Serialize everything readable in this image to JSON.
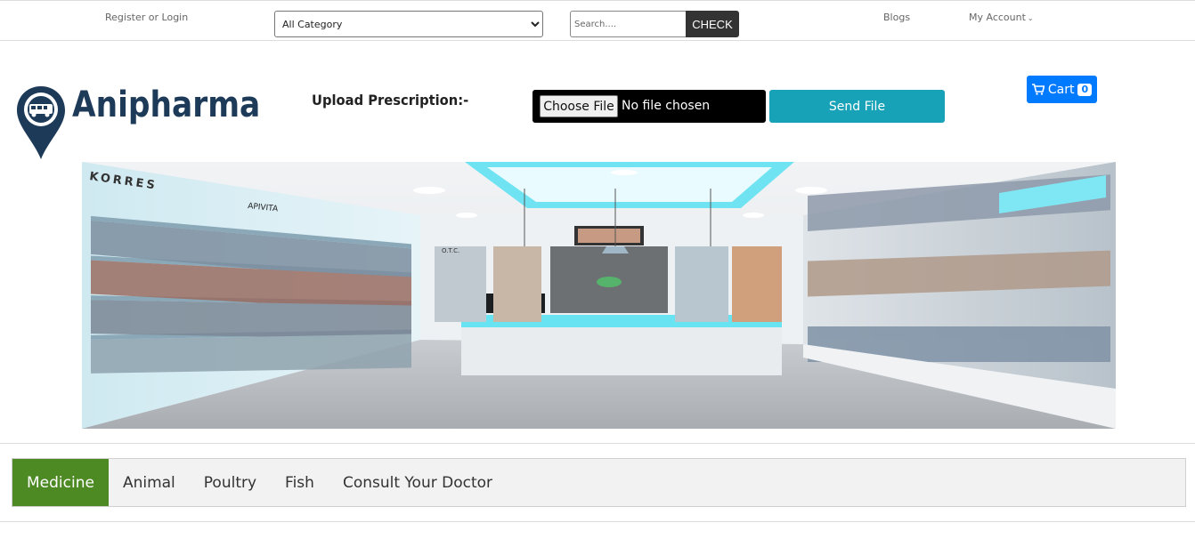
{
  "topbar": {
    "register_login": "Register or Login",
    "category_selected": "All Category",
    "search_placeholder": "Search....",
    "check_label": "CHECK",
    "blogs": "Blogs",
    "my_account": "My Account"
  },
  "brand": {
    "logo_text": "Anipharma",
    "brand_color": "#1d3a58"
  },
  "upload": {
    "label": "Upload Prescription:-",
    "choose_file": "Choose File",
    "no_file": "No file chosen",
    "send_file": "Send File"
  },
  "cart": {
    "label": "Cart",
    "count": "0",
    "icon": "cart-icon"
  },
  "nav": {
    "items": [
      {
        "label": "Medicine"
      },
      {
        "label": "Animal"
      },
      {
        "label": "Poultry"
      },
      {
        "label": "Fish"
      },
      {
        "label": "Consult Your Doctor"
      }
    ],
    "active_color": "#4e8a24"
  },
  "banner": {
    "signs": [
      "KORRES",
      "APIVITA",
      "O.T.C."
    ]
  }
}
